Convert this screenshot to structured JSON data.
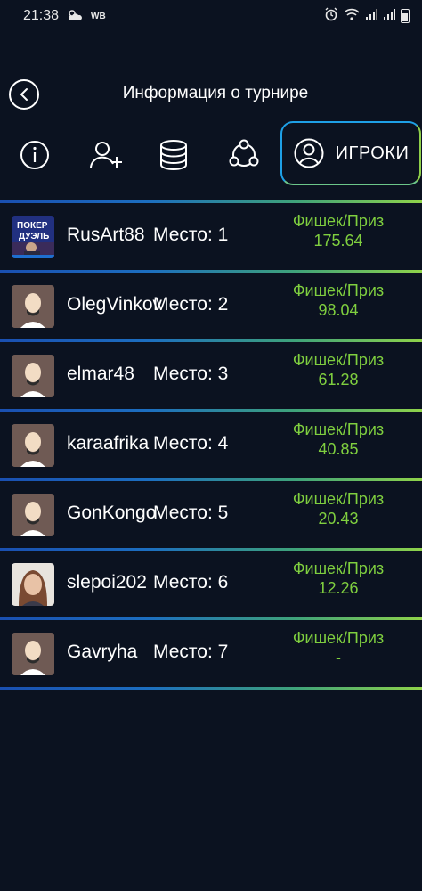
{
  "status_bar": {
    "time": "21:38",
    "carrier_badge": "WB",
    "icons": [
      "cloud-sun-icon",
      "alarm-icon",
      "wifi-icon",
      "signal-icon",
      "signal-icon",
      "battery-icon"
    ]
  },
  "header": {
    "title": "Информация о турнире",
    "back_icon": "chevron-left-icon"
  },
  "tabs": [
    {
      "name": "info",
      "icon": "info-icon"
    },
    {
      "name": "add-player",
      "icon": "user-plus-icon"
    },
    {
      "name": "database",
      "icon": "database-icon"
    },
    {
      "name": "share",
      "icon": "share-icon"
    },
    {
      "name": "players",
      "icon": "user-circle-icon",
      "label": "ИГРОКИ",
      "active": true
    }
  ],
  "prize_label": "Фишек/Приз",
  "place_prefix": "Место: ",
  "players": [
    {
      "nick": "RusArt88",
      "place": "Место: 1",
      "prize_label": "Фишек/Приз",
      "prize": "175.64",
      "avatar": "photo-poker"
    },
    {
      "nick": "OlegVinkov",
      "place": "Место: 2",
      "prize_label": "Фишек/Приз",
      "prize": "98.04",
      "avatar": "default"
    },
    {
      "nick": "elmar48",
      "place": "Место: 3",
      "prize_label": "Фишек/Приз",
      "prize": "61.28",
      "avatar": "default"
    },
    {
      "nick": "karaafrika",
      "place": "Место: 4",
      "prize_label": "Фишек/Приз",
      "prize": "40.85",
      "avatar": "default"
    },
    {
      "nick": "GonKongo",
      "place": "Место: 5",
      "prize_label": "Фишек/Приз",
      "prize": "20.43",
      "avatar": "default"
    },
    {
      "nick": "slepoi202",
      "place": "Место: 6",
      "prize_label": "Фишек/Приз",
      "prize": "12.26",
      "avatar": "photo-woman"
    },
    {
      "nick": "Gavryha",
      "place": "Место: 7",
      "prize_label": "Фишек/Приз",
      "prize": "-",
      "avatar": "default"
    }
  ],
  "colors": {
    "background": "#0b1220",
    "prize_green": "#7fcf3f",
    "accent_blue": "#1ea0e6",
    "accent_green": "#8fd04a"
  }
}
